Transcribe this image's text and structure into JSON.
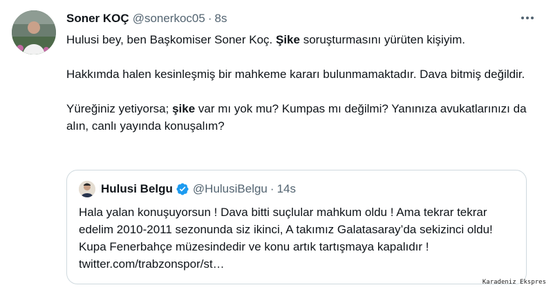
{
  "tweet": {
    "author_name": "Soner KOÇ",
    "author_handle": "@sonerkoc05",
    "dot": "·",
    "time": "8s",
    "line1_before": "Hulusi bey, ben Başkomiser Soner Koç. ",
    "line1_bold": "Şike",
    "line1_after": " soruşturmasını yürüten kişiyim.",
    "paragraph2": "Hakkımda halen kesinleşmiş bir mahkeme kararı bulunmamaktadır. Dava bitmiş değildir.",
    "line3_before": "Yüreğiniz yetiyorsa; ",
    "line3_bold": "şike",
    "line3_after": " var mı yok mu? Kumpas mı değilmi? Yanınıza avukatlarınızı da alın, canlı yayında konuşalım?"
  },
  "quote": {
    "author_name": "Hulusi Belgu",
    "author_handle": "@HulusiBelgu",
    "dot": "·",
    "time": "14s",
    "text": "Hala yalan konuşuyorsun ! Dava bitti suçlular mahkum oldu ! Ama tekrar tekrar edelim 2010-2011 sezonunda siz ikinci, A takımız Galatasaray’da sekizinci oldu! Kupa Fenerbahçe müzesindedir ve konu artık tartışmaya kapalıdır ! twitter.com/trabzonspor/st…"
  },
  "watermark": "Karadeniz Ekspres",
  "icons": {
    "more": "more-options-icon",
    "verified": "verified-badge-icon"
  },
  "colors": {
    "verified": "#1d9bf0",
    "secondary_text": "#536471",
    "border": "#cfd9de"
  }
}
